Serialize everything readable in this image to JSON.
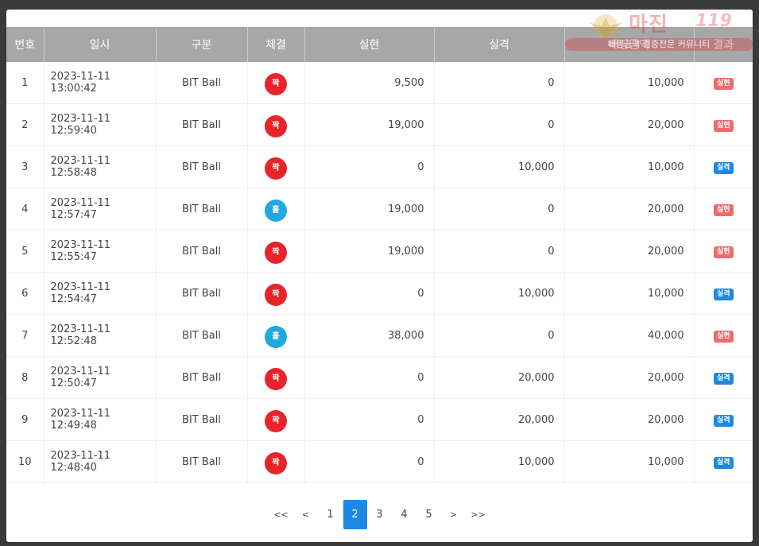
{
  "colors": {
    "header_bg": "#a7a7a7",
    "pick_red": "#e8232c",
    "pick_blue": "#21a8de",
    "badge_win": "#f06a6a",
    "badge_lose": "#1e88e5",
    "page_active": "#1e88e5"
  },
  "watermark": {
    "title": "마진",
    "number": "119",
    "subtitle": "배팅금액 검증전문 커뮤니티",
    "emblem_icon": "eagle-emblem-icon"
  },
  "table": {
    "headers": [
      "번호",
      "일시",
      "구분",
      "체결",
      "실현",
      "실격",
      "배팅금액",
      "결과"
    ],
    "rows": [
      {
        "no": "1",
        "datetime": "2023-11-11 13:00:42",
        "type": "BIT Ball",
        "pick": "짝",
        "pick_color": "red",
        "realized": "9,500",
        "lost": "0",
        "bet": "10,000",
        "result": "실현",
        "result_kind": "win"
      },
      {
        "no": "2",
        "datetime": "2023-11-11 12:59:40",
        "type": "BIT Ball",
        "pick": "짝",
        "pick_color": "red",
        "realized": "19,000",
        "lost": "0",
        "bet": "20,000",
        "result": "실현",
        "result_kind": "win"
      },
      {
        "no": "3",
        "datetime": "2023-11-11 12:58:48",
        "type": "BIT Ball",
        "pick": "짝",
        "pick_color": "red",
        "realized": "0",
        "lost": "10,000",
        "bet": "10,000",
        "result": "실격",
        "result_kind": "lose"
      },
      {
        "no": "4",
        "datetime": "2023-11-11 12:57:47",
        "type": "BIT Ball",
        "pick": "홀",
        "pick_color": "blue",
        "realized": "19,000",
        "lost": "0",
        "bet": "20,000",
        "result": "실현",
        "result_kind": "win"
      },
      {
        "no": "5",
        "datetime": "2023-11-11 12:55:47",
        "type": "BIT Ball",
        "pick": "짝",
        "pick_color": "red",
        "realized": "19,000",
        "lost": "0",
        "bet": "20,000",
        "result": "실현",
        "result_kind": "win"
      },
      {
        "no": "6",
        "datetime": "2023-11-11 12:54:47",
        "type": "BIT Ball",
        "pick": "짝",
        "pick_color": "red",
        "realized": "0",
        "lost": "10,000",
        "bet": "10,000",
        "result": "실격",
        "result_kind": "lose"
      },
      {
        "no": "7",
        "datetime": "2023-11-11 12:52:48",
        "type": "BIT Ball",
        "pick": "홀",
        "pick_color": "blue",
        "realized": "38,000",
        "lost": "0",
        "bet": "40,000",
        "result": "실현",
        "result_kind": "win"
      },
      {
        "no": "8",
        "datetime": "2023-11-11 12:50:47",
        "type": "BIT Ball",
        "pick": "짝",
        "pick_color": "red",
        "realized": "0",
        "lost": "20,000",
        "bet": "20,000",
        "result": "실격",
        "result_kind": "lose"
      },
      {
        "no": "9",
        "datetime": "2023-11-11 12:49:48",
        "type": "BIT Ball",
        "pick": "짝",
        "pick_color": "red",
        "realized": "0",
        "lost": "20,000",
        "bet": "20,000",
        "result": "실격",
        "result_kind": "lose"
      },
      {
        "no": "10",
        "datetime": "2023-11-11 12:48:40",
        "type": "BIT Ball",
        "pick": "짝",
        "pick_color": "red",
        "realized": "0",
        "lost": "10,000",
        "bet": "10,000",
        "result": "실격",
        "result_kind": "lose"
      }
    ]
  },
  "pagination": {
    "first": "<<",
    "prev": "<",
    "pages": [
      "1",
      "2",
      "3",
      "4",
      "5"
    ],
    "current": "2",
    "next": ">",
    "last": ">>"
  }
}
